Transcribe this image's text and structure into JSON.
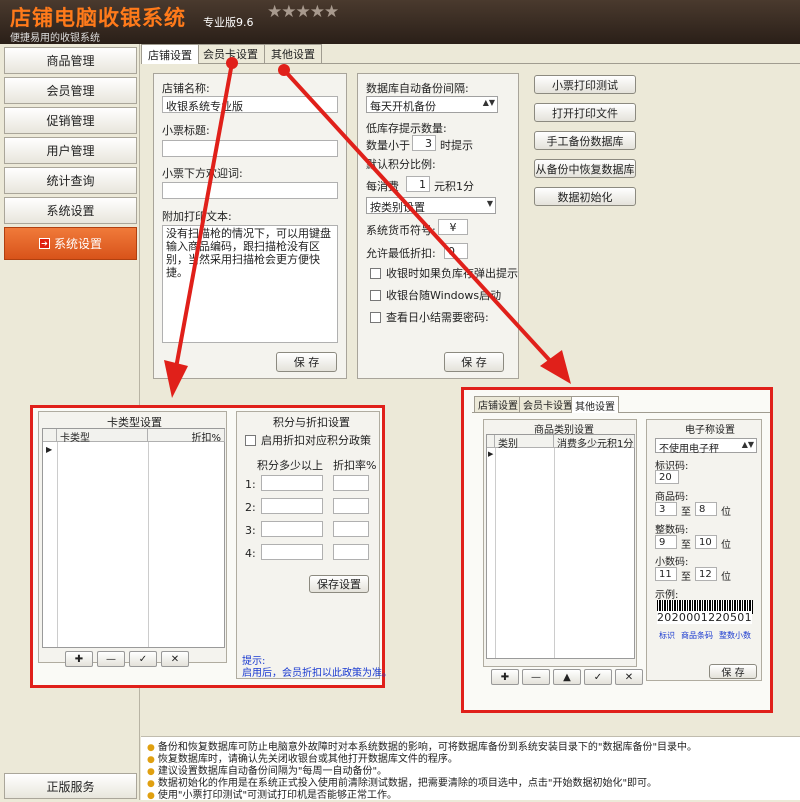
{
  "header": {
    "title": "店铺电脑收银系统",
    "version": "专业版9.6",
    "stars": "★★★★★",
    "slogan": "便捷易用的收银系统"
  },
  "sidebar": {
    "items": [
      "商品管理",
      "会员管理",
      "促销管理",
      "用户管理",
      "统计查询",
      "系统设置"
    ],
    "active": "系统设置",
    "bottom": "正版服务"
  },
  "tabs": [
    "店铺设置",
    "会员卡设置",
    "其他设置"
  ],
  "shop": {
    "name_label": "店铺名称:",
    "name_value": "收银系统专业版",
    "ticket_title_label": "小票标题:",
    "ticket_footer_label": "小票下方欢迎词:",
    "extra_label": "附加打印文本:",
    "extra_text": "没有扫描枪的情况下，可以用键盘输入商品编码，跟扫描枪没有区别，当然采用扫描枪会更方便快捷。",
    "save": "保 存"
  },
  "db": {
    "backup_label": "数据库自动备份间隔:",
    "backup_value": "每天开机备份",
    "low_stock_label": "低库存提示数量:",
    "qty_less": "数量小于",
    "qty_value": "3",
    "qty_suffix": "时提示",
    "points_label": "默认积分比例:",
    "per_spend": "每消费",
    "per_value": "1",
    "per_suffix": "元积1分",
    "category_select": "按类别设置",
    "currency_label": "系统货币符号:",
    "currency_value": "¥",
    "min_discount_label": "允许最低折扣:",
    "min_discount_value": "0",
    "check1": "收银时如果负库存弹出提示",
    "check2": "收银台随Windows启动",
    "check3": "查看日小结需要密码:",
    "save": "保 存"
  },
  "actions": [
    "小票打印测试",
    "打开打印文件",
    "手工备份数据库",
    "从备份中恢复数据库",
    "数据初始化"
  ],
  "card": {
    "title": "卡类型设置",
    "col1": "卡类型",
    "col2": "折扣%",
    "btns": [
      "✚",
      "—",
      "✓",
      "✕"
    ],
    "pd_title": "积分与折扣设置",
    "pd_check": "启用折扣对应积分政策",
    "pd_col1": "积分多少以上",
    "pd_col2": "折扣率%",
    "rows": [
      "1:",
      "2:",
      "3:",
      "4:"
    ],
    "save": "保存设置",
    "hint_title": "提示:",
    "hint_text": "启用后，会员折扣以此政策为准。"
  },
  "other": {
    "tabs": [
      "店铺设置",
      "会员卡设置",
      "其他设置"
    ],
    "cat_title": "商品类别设置",
    "col1": "类别",
    "col2": "消费多少元积1分",
    "btns": [
      "✚",
      "—",
      "▲",
      "✓",
      "✕"
    ],
    "scale_title": "电子称设置",
    "scale_select": "不使用电子秤",
    "flag_label": "标识码:",
    "flag_value": "20",
    "goods_label": "商品码:",
    "goods_from": "3",
    "goods_to": "8",
    "whole_label": "整数码:",
    "whole_from": "9",
    "whole_to": "10",
    "dec_label": "小数码:",
    "dec_from": "11",
    "dec_to": "12",
    "to": "至",
    "pos": "位",
    "example_label": "示例:",
    "barcode": "2020001220501",
    "legend": [
      "标识",
      "商品条码",
      "整数",
      "小数"
    ],
    "save": "保 存"
  },
  "tips": [
    "备份和恢复数据库可防止电脑意外故障时对本系统数据的影响，可将数据库备份到系统安装目录下的\"数据库备份\"目录中。",
    "恢复数据库时，请确认先关闭收银台或其他打开数据库文件的程序。",
    "建议设置数据库自动备份间隔为\"每周一自动备份\"。",
    "数据初始化的作用是在系统正式投入使用前清除测试数据，把需要清除的项目选中，点击\"开始数据初始化\"即可。",
    "使用\"小票打印测试\"可测试打印机是否能够正常工作。"
  ],
  "colors": {
    "accent": "#e0201a",
    "active": "#e0601e"
  }
}
